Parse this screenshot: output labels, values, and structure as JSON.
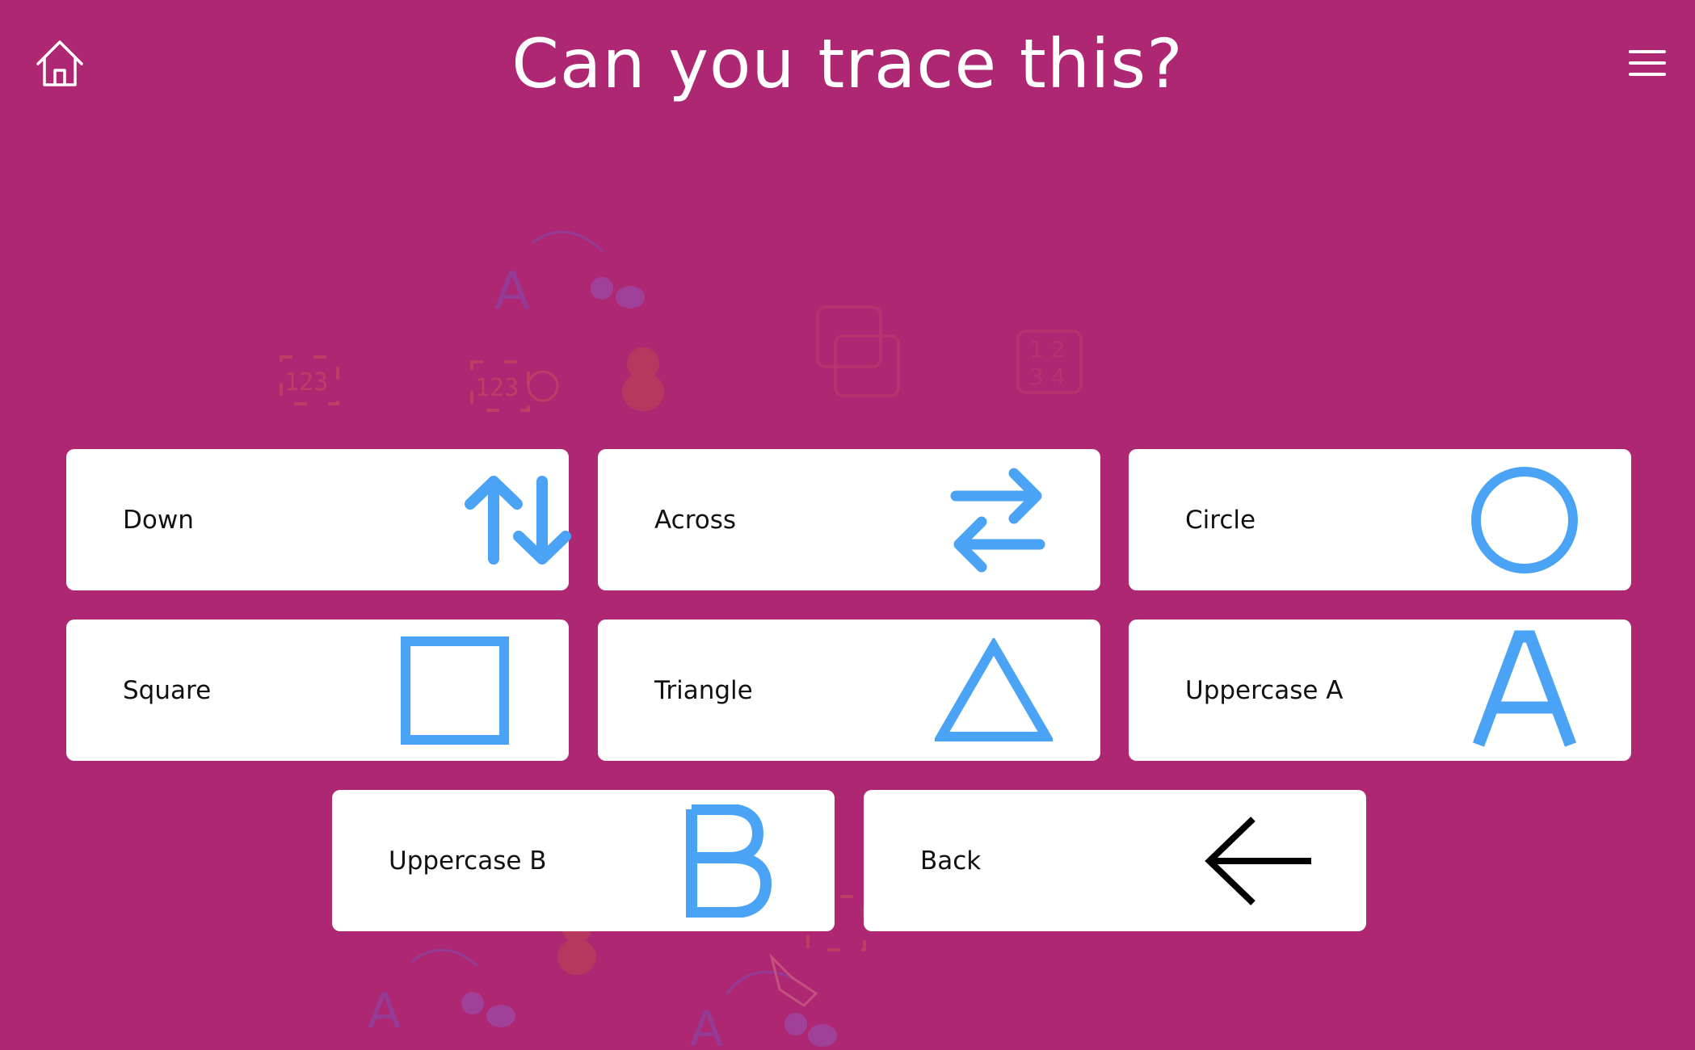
{
  "header": {
    "title": "Can you trace this?",
    "home_icon": "home-icon",
    "menu_icon": "hamburger-menu-icon"
  },
  "colors": {
    "background": "#ad2773",
    "card": "#ffffff",
    "icon_blue": "#4aa3f4",
    "back_arrow": "#000000"
  },
  "options": [
    {
      "label": "Down",
      "icon": "up-down-arrows-icon"
    },
    {
      "label": "Across",
      "icon": "left-right-arrows-icon"
    },
    {
      "label": "Circle",
      "icon": "circle-icon"
    },
    {
      "label": "Square",
      "icon": "square-icon"
    },
    {
      "label": "Triangle",
      "icon": "triangle-icon"
    },
    {
      "label": "Uppercase A",
      "icon": "letter-a-icon",
      "glyph": "A"
    },
    {
      "label": "Uppercase B",
      "icon": "letter-b-icon",
      "glyph": "B"
    },
    {
      "label": "Back",
      "icon": "back-arrow-icon"
    }
  ]
}
